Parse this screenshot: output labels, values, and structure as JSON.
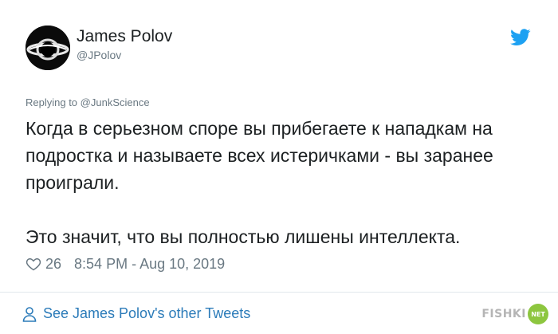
{
  "tweet": {
    "author": {
      "name": "James Polov",
      "handle": "@JPolov",
      "avatar_icon": "black-hole-eye-icon"
    },
    "reply_to": {
      "prefix": "Replying to ",
      "handle": "@JunkScience"
    },
    "text": {
      "paragraph_1": "Когда в серьезном споре вы прибегаете к нападкам на подростка и называете всех истеричками - вы заранее проиграли.",
      "paragraph_2": "Это значит, что вы полностью лишены интеллекта."
    },
    "likes": "26",
    "timestamp": "8:54 PM - Aug 10, 2019",
    "footer_link": "See James Polov's other Tweets"
  },
  "watermark": {
    "text": "FISHKI",
    "badge": "NET"
  },
  "colors": {
    "twitter_blue": "#1da1f2",
    "link_blue": "#2b7bb9",
    "muted_gray": "#697882",
    "text_dark": "#1c2022",
    "divider": "#e1e8ed",
    "watermark_green": "#8dc63f"
  }
}
